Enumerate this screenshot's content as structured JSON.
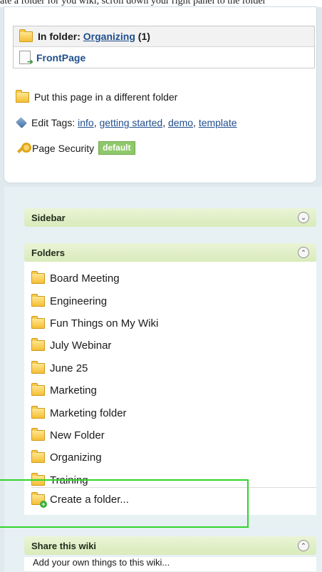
{
  "top_text": "ate a folder for you wiki, scroll down your right panel to the folder",
  "folder_box": {
    "prefix": "In folder:",
    "folder_name": "Organizing",
    "count": "(1)",
    "page_name": "FrontPage"
  },
  "actions": {
    "move_label": "Put this page in a different folder",
    "edit_tags_prefix": "Edit Tags:",
    "tags": [
      "info",
      "getting started",
      "demo",
      "template"
    ],
    "security_label": "Page Security",
    "security_badge": "default"
  },
  "panels": {
    "sidebar": "Sidebar",
    "folders": "Folders",
    "share": "Share this wiki",
    "share_partial": "Add your own things to this wiki..."
  },
  "folders": [
    "Board Meeting",
    "Engineering",
    "Fun Things on My Wiki",
    "July Webinar",
    "June 25",
    "Marketing",
    "Marketing folder",
    "New Folder",
    "Organizing",
    "Training"
  ],
  "create_folder": "Create a folder...",
  "colors": {
    "accent_green": "#31d42b",
    "link": "#1f4e8c",
    "badge_green": "#8fc86a",
    "panel_header": "#d9ebbc"
  }
}
